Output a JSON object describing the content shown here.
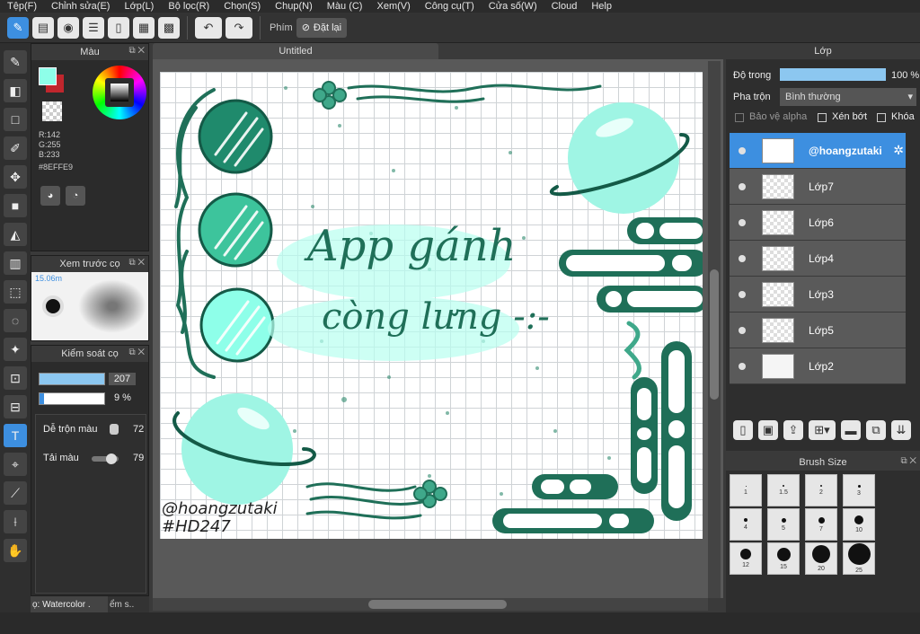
{
  "menu": [
    "Tệp(F)",
    "Chỉnh sửa(E)",
    "Lớp(L)",
    "Bộ lọc(R)",
    "Chọn(S)",
    "Chụp(N)",
    "Màu (C)",
    "Xem(V)",
    "Công cụ(T)",
    "Cửa số(W)",
    "Cloud",
    "Help"
  ],
  "toolbar": {
    "keys_label": "Phím",
    "reset_label": "Đặt lại"
  },
  "color_panel": {
    "title": "Màu",
    "r": "R:142",
    "g": "G:255",
    "b": "B:233",
    "hex": "#8EFFE9",
    "fg_color": "#8effe9",
    "bg_color": "#c0262d"
  },
  "preview_panel": {
    "title": "Xem trước cọ",
    "size": "15.06m"
  },
  "brush_control": {
    "title": "Kiểm soát cọ",
    "size_value": "207",
    "opacity_value": "9 %",
    "mix_label": "Dễ trộn màu",
    "mix_value": "72",
    "load_label": "Tải màu",
    "load_value": "79"
  },
  "brush_tabs": [
    "ọ: Watercolor .",
    "ểm s.."
  ],
  "canvas": {
    "title": "Untitled",
    "heading_line1": "App gánh",
    "heading_line2": "còng lưng -:-",
    "watermark1": "@hoangzutaki",
    "watermark2": "#HD247"
  },
  "layers_panel": {
    "title": "Lớp",
    "opacity_label": "Độ trong",
    "opacity_value": "100 %",
    "blend_label": "Pha trộn",
    "blend_value": "Bình thường",
    "protect_alpha": "Bảo vệ alpha",
    "clip": "Xén bớt",
    "lock": "Khóa",
    "layers": [
      "@hoangzutaki",
      "Lớp7",
      "Lớp6",
      "Lớp4",
      "Lớp3",
      "Lớp5",
      "Lớp2"
    ]
  },
  "brush_size_panel": {
    "title": "Brush Size",
    "sizes": [
      "1",
      "1.5",
      "2",
      "3",
      "4",
      "5",
      "7",
      "10",
      "12",
      "15",
      "20",
      "25"
    ]
  }
}
